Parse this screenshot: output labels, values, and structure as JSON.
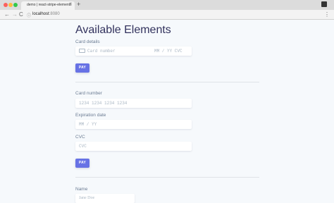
{
  "browser": {
    "tab_title": "demo | react-stripe-elements",
    "tab_close": "×",
    "new_tab": "+",
    "url_host": "localhost",
    "url_port": ":8080",
    "back": "←",
    "forward": "→",
    "reload": "C",
    "menu": "⋮",
    "url_icon": "ⓘ"
  },
  "page": {
    "title": "Available Elements",
    "section1": {
      "card_label": "Card details",
      "card_placeholder": "Card number",
      "card_expiry_cvc": "MM / YY CVC",
      "pay_label": "PAY"
    },
    "section2": {
      "card_number_label": "Card number",
      "card_number_placeholder": "1234 1234 1234 1234",
      "expiration_label": "Expiration date",
      "expiration_placeholder": "MM / YY",
      "cvc_label": "CVC",
      "cvc_placeholder": "CVC",
      "pay_label": "PAY"
    },
    "section3": {
      "name_label": "Name",
      "name_placeholder": "Jane Doe"
    }
  },
  "colors": {
    "accent": "#6772e5",
    "heading": "#32325d",
    "label": "#6b7c93",
    "placeholder": "#aab7c4",
    "background": "#f6f9fc"
  }
}
